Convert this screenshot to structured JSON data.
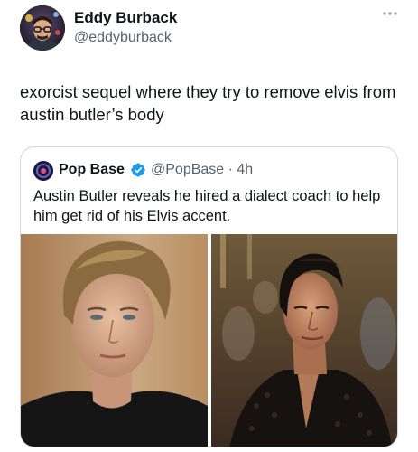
{
  "author": {
    "name": "Eddy Burback",
    "handle": "@eddyburback"
  },
  "tweet": {
    "text": "exorcist sequel where they try to remove elvis from austin butler’s body"
  },
  "quoted": {
    "name": "Pop Base",
    "handle": "@PopBase",
    "time": "4h",
    "text": "Austin Butler reveals he hired a dialect coach to help him get rid of his Elvis accent."
  },
  "icons": {
    "more": "more-dots-icon",
    "verified": "verified-badge-icon"
  },
  "colors": {
    "verified": "#1d9bf0",
    "secondary_text": "#536471",
    "border": "#cfd9de"
  }
}
